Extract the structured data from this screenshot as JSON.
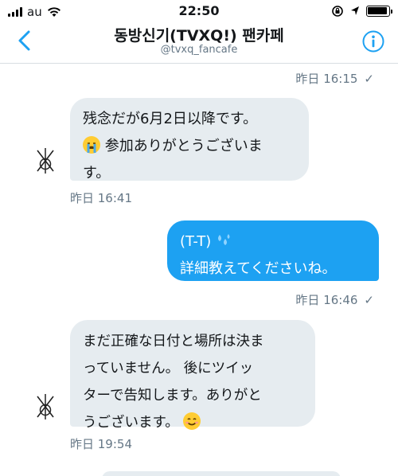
{
  "status_bar": {
    "carrier": "au",
    "time": "22:50"
  },
  "header": {
    "title": "동방신기(TVXQ!) 팬카페",
    "handle": "@tvxq_fancafe",
    "accent_color": "#1da1f2"
  },
  "messages": [
    {
      "kind": "timestamp",
      "text": "昨日 16:15",
      "read_check": "✓"
    },
    {
      "kind": "incoming",
      "lines": [
        "残念だが6月2日以降です。",
        "参加ありがとうございま",
        "す。"
      ],
      "emoji": "crying-face",
      "time": "昨日 16:41"
    },
    {
      "kind": "outgoing",
      "lines": [
        "(T-T)",
        "詳細教えてくださいね。"
      ],
      "emoji": "sweat-droplets",
      "time": "昨日 16:46",
      "read_check": "✓"
    },
    {
      "kind": "incoming",
      "lines": [
        "まだ正確な日付と場所は決ま",
        "っていません。 後にツイッ",
        "ターで告知します。ありがと",
        "うございます。"
      ],
      "emoji": "smiling-face",
      "time": "昨日 19:54"
    }
  ]
}
